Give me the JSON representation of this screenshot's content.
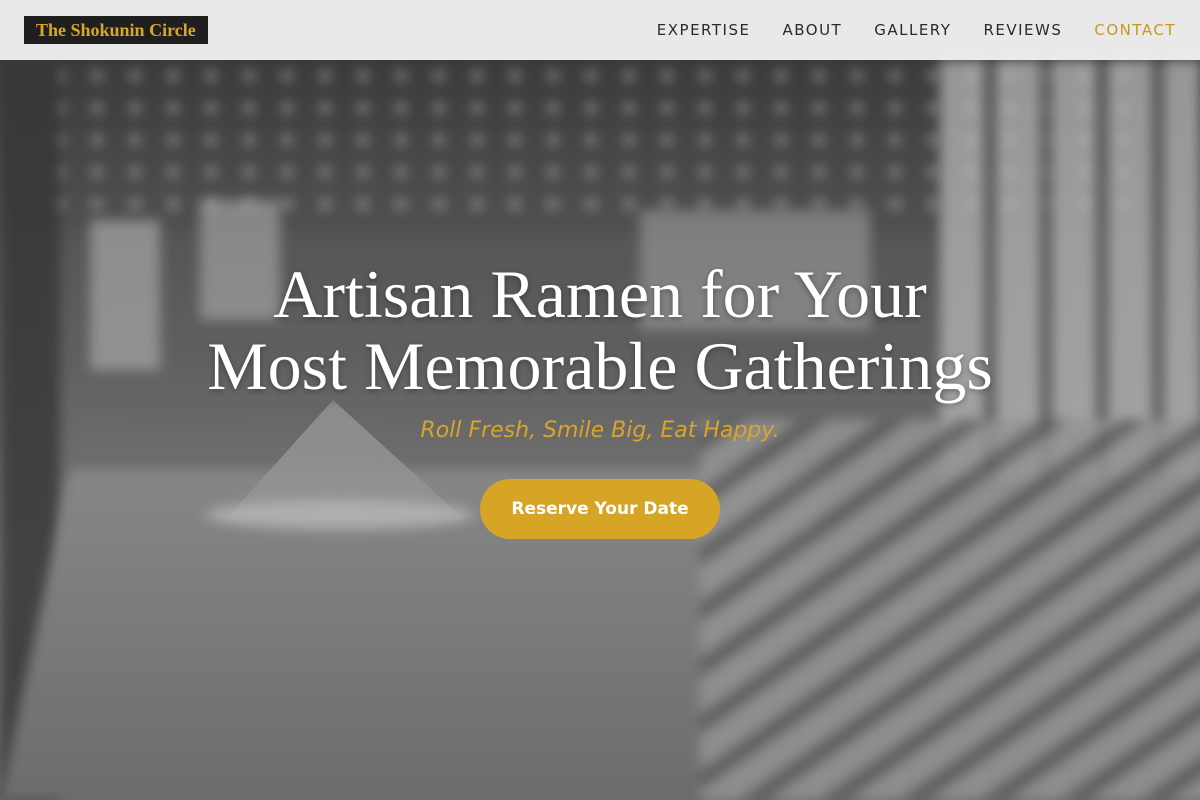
{
  "header": {
    "logo": "The Shokunin Circle",
    "nav": [
      {
        "label": "EXPERTISE"
      },
      {
        "label": "ABOUT"
      },
      {
        "label": "GALLERY"
      },
      {
        "label": "REVIEWS"
      },
      {
        "label": "CONTACT"
      }
    ],
    "active_nav": "CONTACT"
  },
  "hero": {
    "headline_line1": "Artisan Ramen for Your",
    "headline_line2": "Most Memorable Gatherings",
    "tagline": "Roll Fresh, Smile Big, Eat Happy.",
    "cta_label": "Reserve Your Date"
  },
  "colors": {
    "accent": "#d6a526",
    "header_bg": "#f0f0f0",
    "logo_bg": "#1f1f1f",
    "text_dark": "#2a2a2a"
  }
}
